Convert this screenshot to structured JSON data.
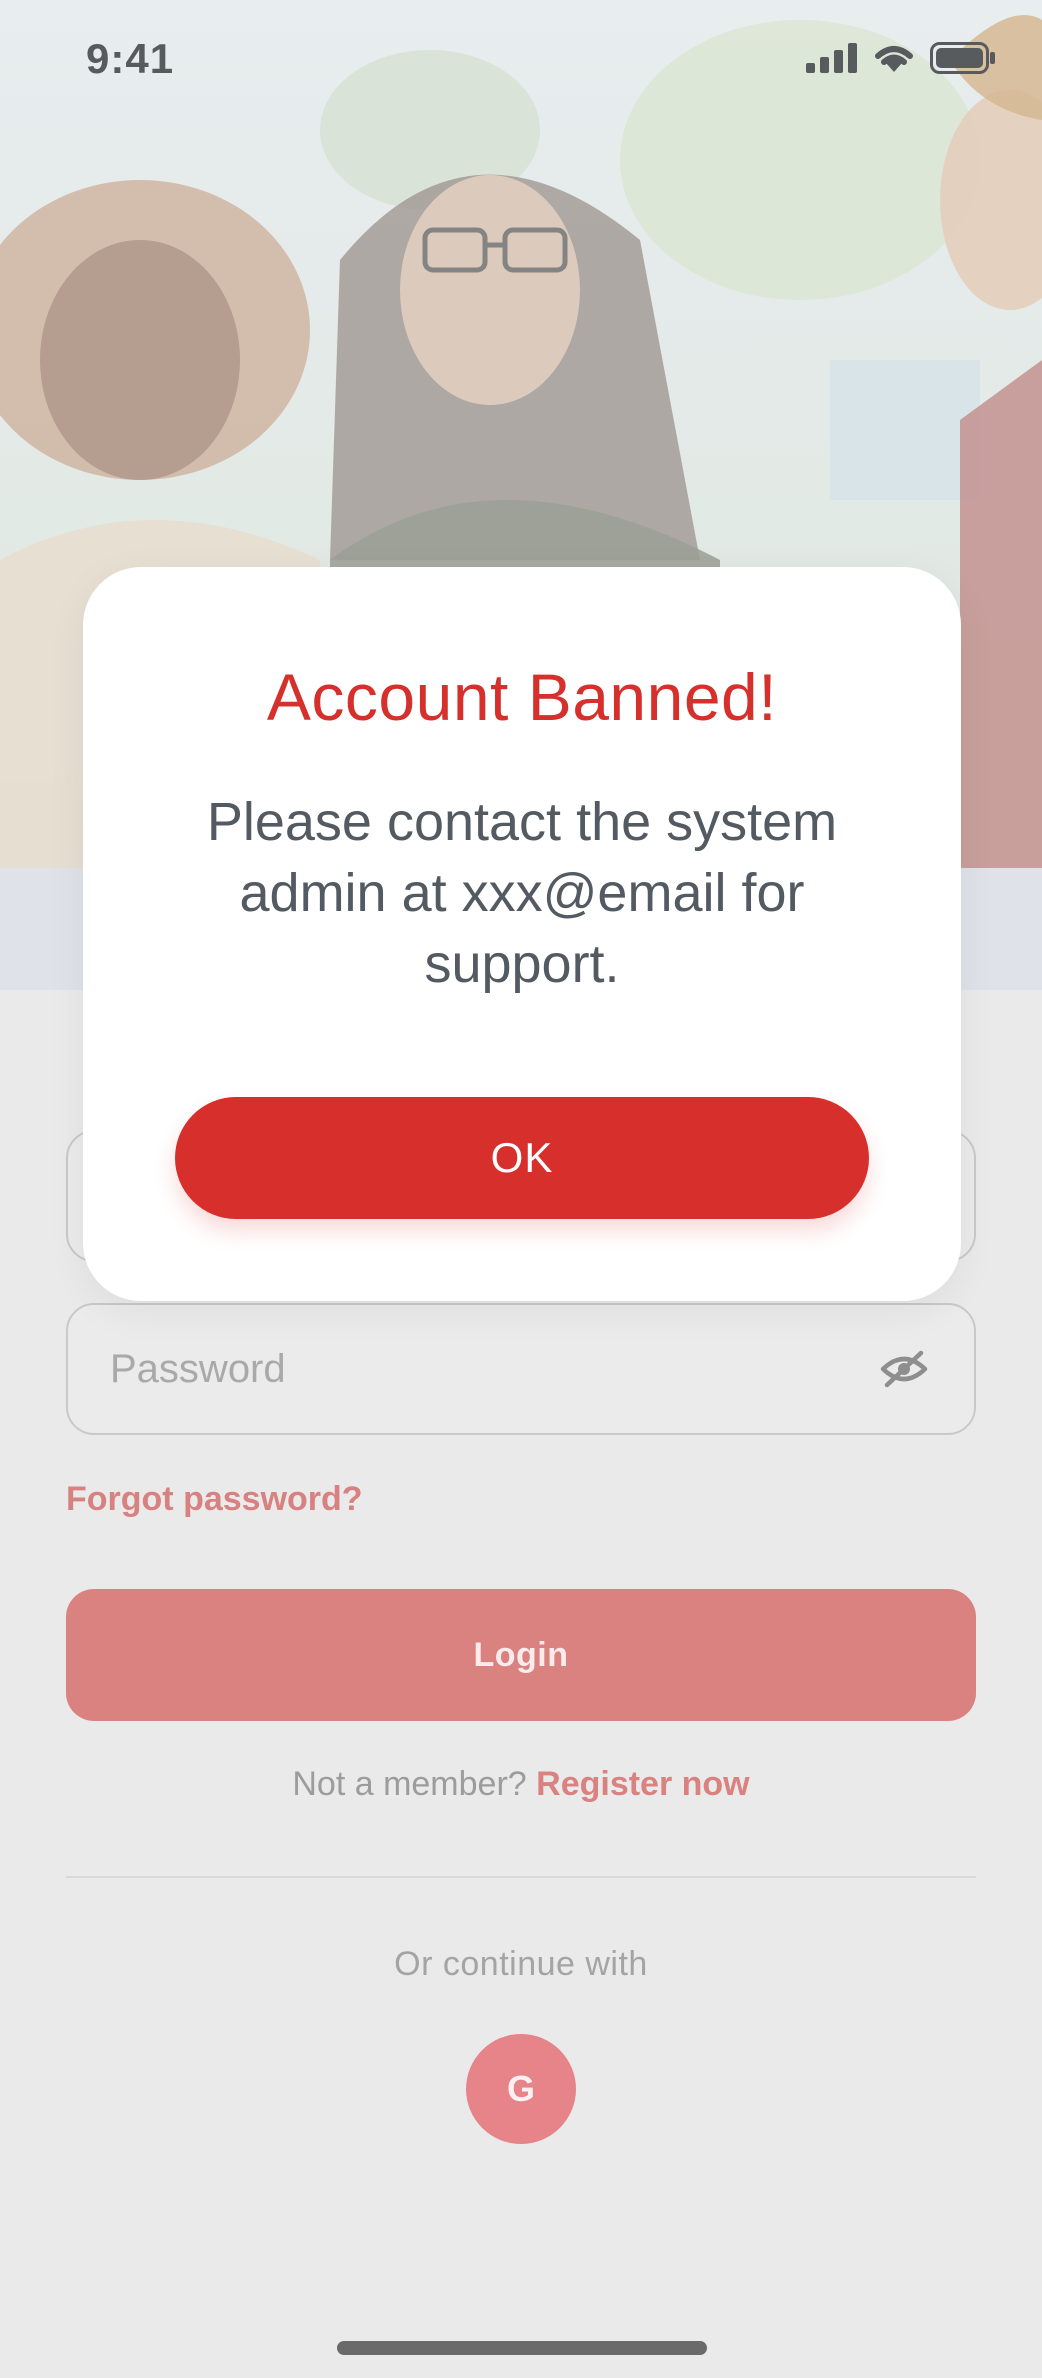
{
  "status_bar": {
    "time": "9:41",
    "icons": [
      "cellular-signal-icon",
      "wifi-icon",
      "battery-icon"
    ]
  },
  "hero": {
    "image_description_icon": "hero-photo"
  },
  "login_form": {
    "password_placeholder": "Password",
    "forgot_password_label": "Forgot password?",
    "login_label": "Login",
    "register_prefix": "Not a member?",
    "register_link": "Register now",
    "or_continue_label": "Or continue with",
    "google_label": "G"
  },
  "modal": {
    "title": "Account Banned!",
    "message": "Please contact the system admin at xxx@email for support.",
    "ok_label": "OK"
  },
  "colors": {
    "accent": "#d7302c",
    "accent_muted": "#d98280",
    "modal_message": "#545a61",
    "background": "#eaeaea"
  }
}
